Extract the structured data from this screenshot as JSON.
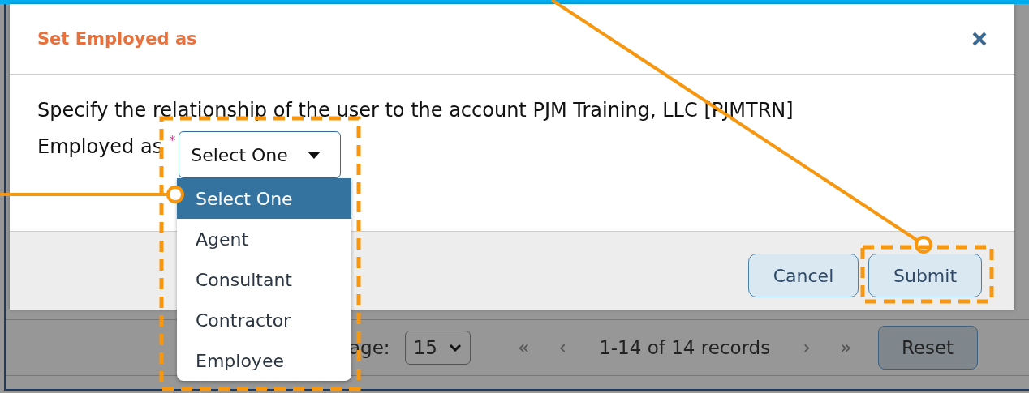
{
  "dialog": {
    "title": "Set Employed as",
    "message": "Specify the relationship of the user to the account PJM Training, LLC [PJMTRN]",
    "field": {
      "label": "Employed as",
      "required": true,
      "required_mark": "*",
      "value": "Select One",
      "expanded": true,
      "options": [
        {
          "label": "Select One",
          "selected": true
        },
        {
          "label": "Agent",
          "selected": false
        },
        {
          "label": "Consultant",
          "selected": false
        },
        {
          "label": "Contractor",
          "selected": false
        },
        {
          "label": "Employee",
          "selected": false
        }
      ]
    },
    "buttons": [
      "Cancel",
      "Submit"
    ]
  },
  "pagination": {
    "page_size_label": "age:",
    "page_size": "15",
    "first": "«",
    "previous": "‹",
    "range": "1-14 of 14 records",
    "next": "›",
    "last": "»",
    "reset": "Reset"
  }
}
